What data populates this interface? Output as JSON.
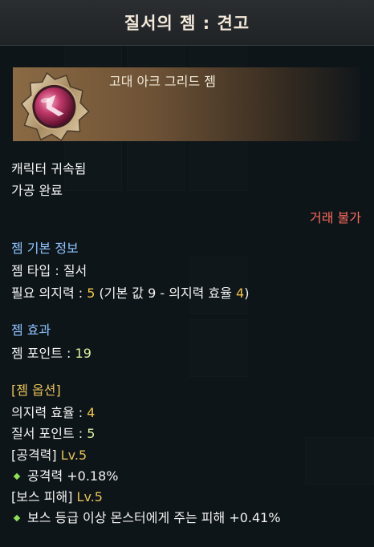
{
  "title": "질서의 젬 : 견고",
  "gem": {
    "grade": "고대 아크 그리드 젬",
    "icon": "order-gem-icon"
  },
  "binding": "캐릭터 귀속됨",
  "process": "가공 완료",
  "trade": "거래 불가",
  "basic_info": {
    "header": "젬 기본 정보",
    "type_label": "젬 타입 : ",
    "type_value": "질서",
    "willpower_label": "필요 의지력 : ",
    "willpower_value": "5",
    "willpower_detail_pre": " (기본 값 9 - 의지력 효율 ",
    "willpower_detail_num": "4",
    "willpower_detail_post": ")"
  },
  "effect": {
    "header": "젬 효과",
    "point_label": "젬 포인트 : ",
    "point_value": "19"
  },
  "options": {
    "header": "[젬 옵션]",
    "efficiency_label": "의지력 효율 : ",
    "efficiency_value": "4",
    "order_point_label": "질서 포인트 : ",
    "order_point_value": "5",
    "attack_name": "[공격력] ",
    "attack_level": "Lv.5",
    "attack_effect": "공격력 +0.18%",
    "boss_name": "[보스 피해] ",
    "boss_level": "Lv.5",
    "boss_effect": "보스 등급 이상 몬스터에게 주는 피해 +0.41%"
  },
  "colors": {
    "section_header": "#8fc4ff",
    "option_header": "#e5c15a",
    "trade_warning": "#ff6b5e",
    "bullet": "#8ee05a"
  }
}
